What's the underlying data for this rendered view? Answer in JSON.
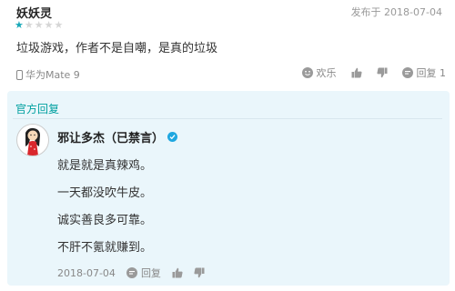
{
  "review": {
    "user_name": "妖妖灵",
    "posted_label": "发布于 2018-07-04",
    "rating": 1,
    "rating_max": 5,
    "text": "垃圾游戏，作者不是自嘲，是真的垃圾",
    "device": "华为Mate 9",
    "actions": {
      "fun_label": "欢乐",
      "reply_label": "回复 1"
    }
  },
  "official_reply": {
    "section_label": "官方回复",
    "responder_name": "邪让多杰（已禁言）",
    "lines": [
      "就是就是真辣鸡。",
      "一天都没吹牛皮。",
      "诚实善良多可靠。",
      "不肝不氪就赚到。"
    ],
    "date": "2018-07-04",
    "reply_label": "回复"
  },
  "colors": {
    "star_filled": "#18a8b8",
    "star_empty": "#d6d6d6",
    "accent": "#00a0a0",
    "panel_bg": "#eaf6fb",
    "badge": "#1fa7e0"
  },
  "icons": [
    "phone-icon",
    "smile-icon",
    "thumbs-up-icon",
    "thumbs-down-icon",
    "comment-icon",
    "verified-icon"
  ]
}
